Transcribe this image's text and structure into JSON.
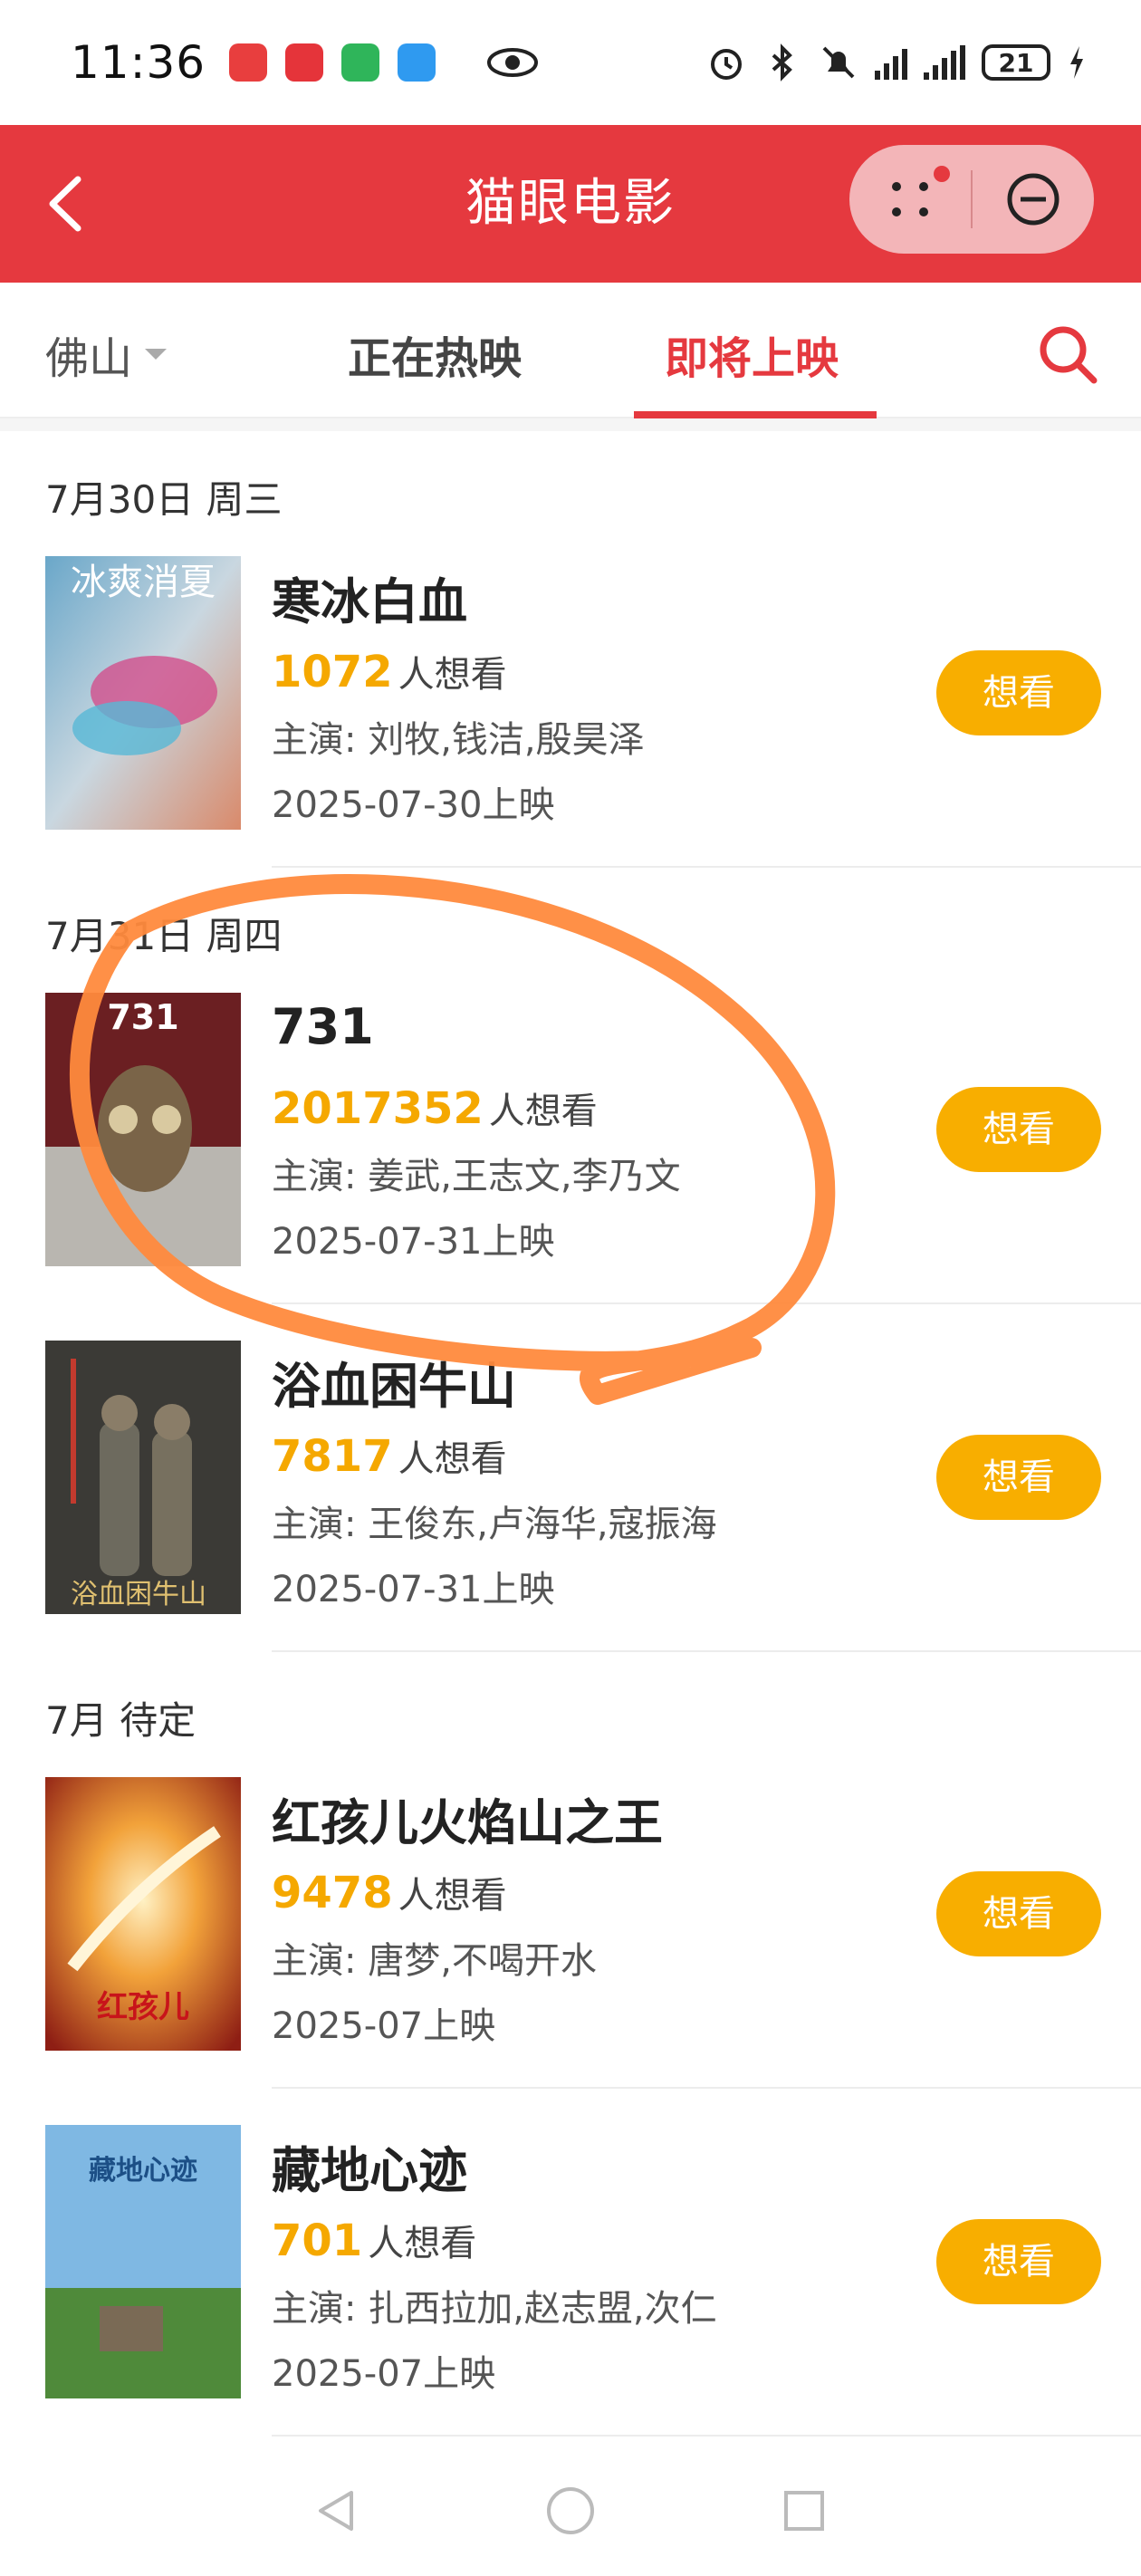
{
  "status_bar": {
    "time": "11:36",
    "battery": "21",
    "apps": [
      {
        "name": "huawei-app-icon",
        "color": "#e83e3e"
      },
      {
        "name": "red-app-icon",
        "color": "#e5343a"
      },
      {
        "name": "green-app-icon",
        "color": "#2fb55a"
      },
      {
        "name": "message-app-icon",
        "color": "#2f9af0"
      }
    ]
  },
  "header": {
    "title": "猫眼电影",
    "background": "#e5393f"
  },
  "tabs": {
    "city": "佛山",
    "now_showing": "正在热映",
    "coming_soon": "即将上映",
    "active": "即将上映"
  },
  "want_label": "想看",
  "want_suffix": "人想看",
  "cast_prefix": "主演: ",
  "groups": [
    {
      "date": "7月30日 周三",
      "movies": [
        {
          "title": "寒冰白血",
          "want": "1072",
          "cast": "刘牧,钱洁,殷昊泽",
          "release": "2025-07-30上映",
          "poster_text": "冰爽消夏"
        }
      ]
    },
    {
      "date": "7月31日 周四",
      "movies": [
        {
          "title": "731",
          "want": "2017352",
          "cast": "姜武,王志文,李乃文",
          "release": "2025-07-31上映",
          "poster_text": "731"
        },
        {
          "title": "浴血困牛山",
          "want": "7817",
          "cast": "王俊东,卢海华,寇振海",
          "release": "2025-07-31上映",
          "poster_text": "浴血困牛山"
        }
      ]
    },
    {
      "date": "7月 待定",
      "movies": [
        {
          "title": "红孩儿火焰山之王",
          "want": "9478",
          "cast": "唐梦,不喝开水",
          "release": "2025-07上映",
          "poster_text": "红孩儿"
        },
        {
          "title": "藏地心迹",
          "want": "701",
          "cast": "扎西拉加,赵志盟,次仁",
          "release": "2025-07上映",
          "poster_text": "藏地心迹"
        }
      ]
    }
  ],
  "colors": {
    "accent": "#e5393f",
    "want_count": "#f5a800",
    "want_button": "#f8ae00",
    "annotation_stroke": "#ff8a3d"
  }
}
